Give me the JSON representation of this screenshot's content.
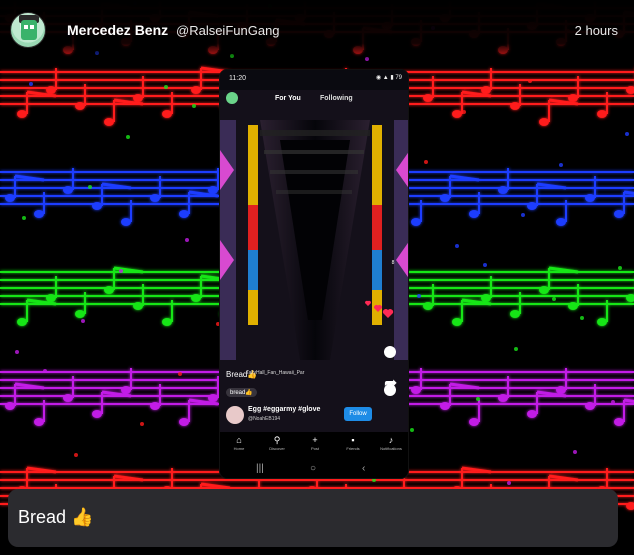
{
  "post": {
    "display_name": "Mercedez Benz",
    "handle": "@RalseiFunGang",
    "time": "2 hours",
    "message": "Bread 👍"
  },
  "phone": {
    "clock": "11:20",
    "status_icons": "◉ ▲ ▮ 79",
    "tab_for_you": "For You",
    "tab_following": "Following",
    "like_count": "8",
    "caption_prefix": "Bread👍",
    "caption_user": "TallyHall_Fan_Hawaii_Par",
    "comment": "bread👍",
    "egg_title": "Egg #eggarmy #glove",
    "egg_user": "@NoahEB194",
    "follow_label": "Follow",
    "nav": {
      "home": "Home",
      "discover": "Discover",
      "post": "Post",
      "friends": "Friends",
      "notifications": "Notifications"
    },
    "sys_recent": "|||",
    "sys_home": "○",
    "sys_back": "‹"
  },
  "colors": {
    "staff_red": "#ff1a1a",
    "staff_blue": "#1f3cff",
    "staff_green": "#19e619",
    "staff_purple": "#c21ce6",
    "message_box": "#2b2b2f",
    "follow_button": "#1e8ce6"
  }
}
